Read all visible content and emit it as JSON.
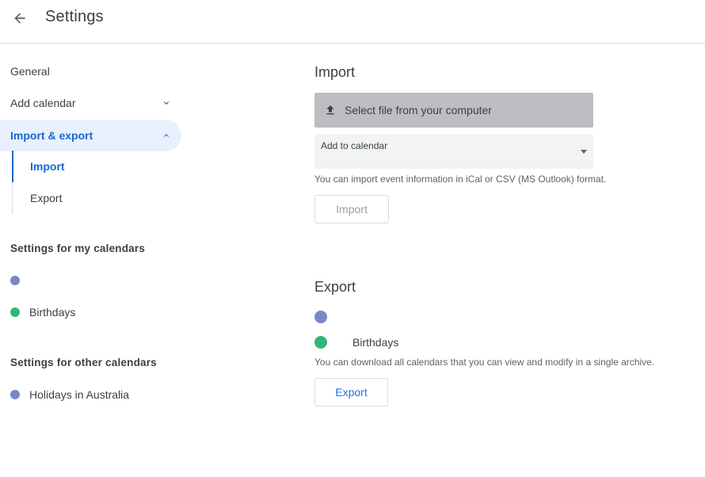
{
  "header": {
    "title": "Settings",
    "back_icon": "arrow-back-icon"
  },
  "sidebar": {
    "items": [
      {
        "label": "General"
      },
      {
        "label": "Add calendar"
      },
      {
        "label": "Import & export"
      }
    ],
    "sub_items": [
      {
        "label": "Import"
      },
      {
        "label": "Export"
      }
    ],
    "my_calendars_title": "Settings for my calendars",
    "my_calendars": [
      {
        "label": "",
        "color": "#7986cb"
      },
      {
        "label": "Birthdays",
        "color": "#33b679"
      }
    ],
    "other_calendars_title": "Settings for other calendars",
    "other_calendars": [
      {
        "label": "Holidays in Australia",
        "color": "#7986cb"
      }
    ]
  },
  "import": {
    "title": "Import",
    "select_file_label": "Select file from your computer",
    "add_to_calendar_label": "Add to calendar",
    "hint": "You can import event information in iCal or CSV (MS Outlook) format.",
    "button_label": "Import"
  },
  "export": {
    "title": "Export",
    "calendars": [
      {
        "label": "",
        "color": "#7986cb"
      },
      {
        "label": "Birthdays",
        "color": "#33b679"
      }
    ],
    "hint": "You can download all calendars that you can view and modify in a single archive.",
    "button_label": "Export"
  },
  "colors": {
    "accent": "#1967d2",
    "active_bg": "#e8f0fe"
  }
}
